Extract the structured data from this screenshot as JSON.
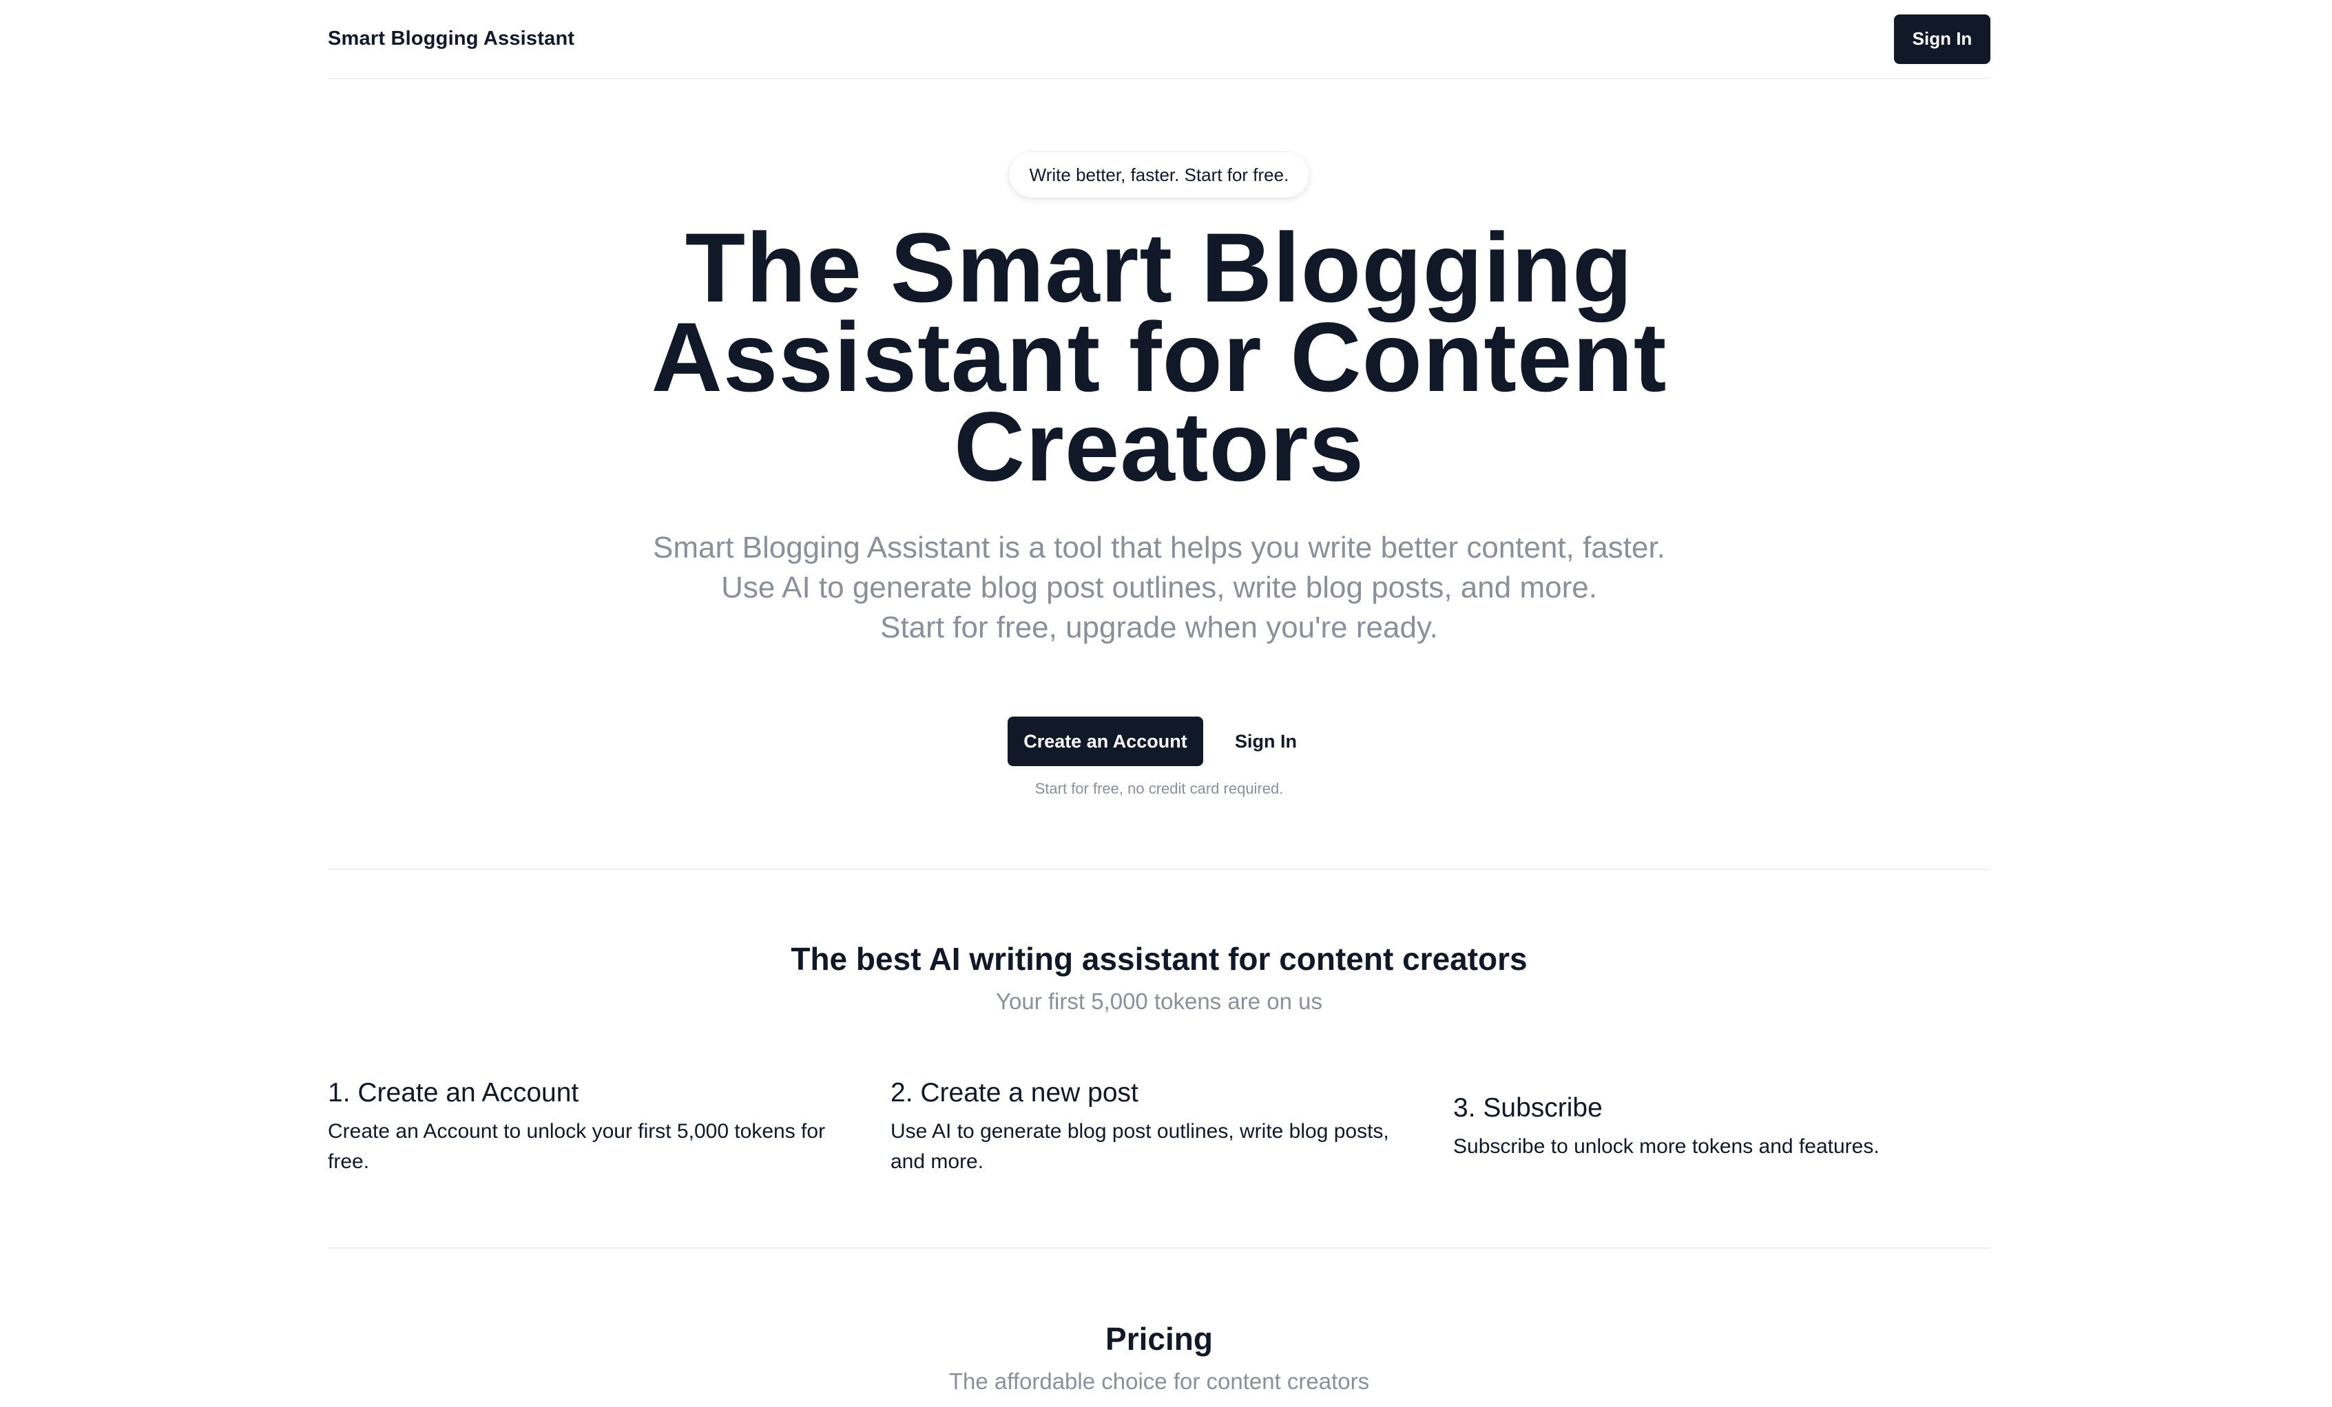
{
  "header": {
    "brand": "Smart Blogging Assistant",
    "sign_in_label": "Sign In"
  },
  "hero": {
    "badge": "Write better, faster. Start for free.",
    "title": "The Smart Blogging Assistant for Content Creators",
    "subtitle_lines": [
      "Smart Blogging Assistant is a tool that helps you write better content, faster.",
      "Use AI to generate blog post outlines, write blog posts, and more.",
      "Start for free, upgrade when you're ready."
    ],
    "primary_cta": "Create an Account",
    "secondary_cta": "Sign In",
    "note": "Start for free, no credit card required."
  },
  "features": {
    "title": "The best AI writing assistant for content creators",
    "subtitle": "Your first 5,000 tokens are on us",
    "steps": [
      {
        "title": "1. Create an Account",
        "description": "Create an Account to unlock your first 5,000 tokens for free."
      },
      {
        "title": "2. Create a new post",
        "description": "Use AI to generate blog post outlines, write blog posts, and more."
      },
      {
        "title": "3. Subscribe",
        "description": "Subscribe to unlock more tokens and features."
      }
    ]
  },
  "pricing": {
    "title": "Pricing",
    "subtitle": "The affordable choice for content creators"
  },
  "colors": {
    "primary": "#111827",
    "muted_text": "#8a8f99",
    "divider": "#eef0f3",
    "background": "#ffffff"
  }
}
